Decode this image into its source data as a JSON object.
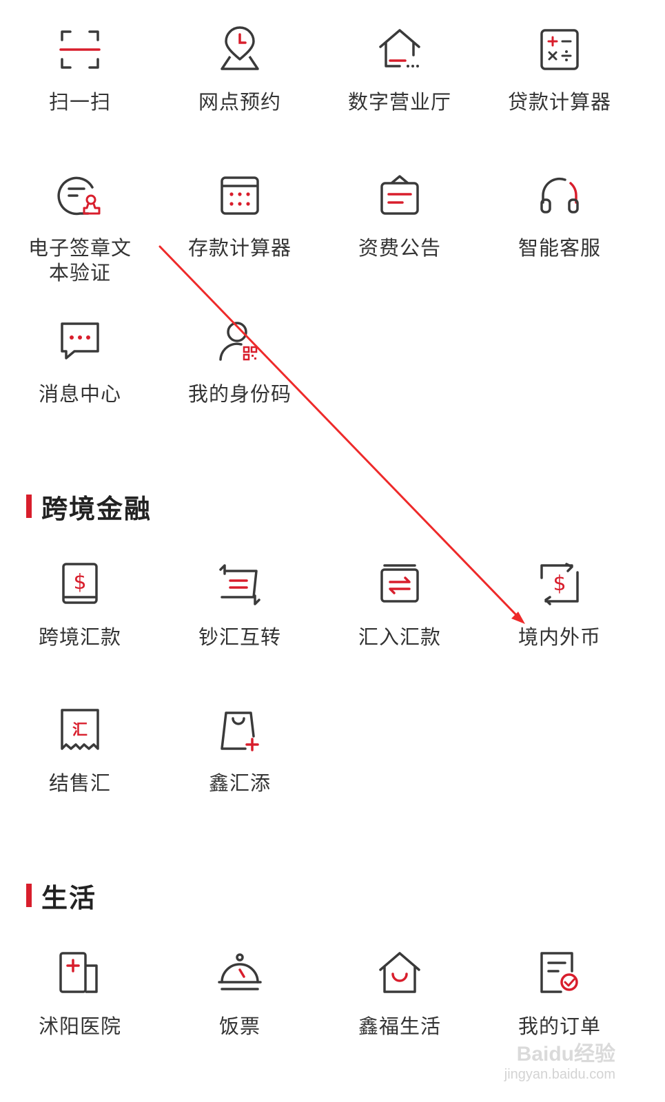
{
  "colors": {
    "accent": "#d81e2c",
    "icon_stroke": "#3a3a3a",
    "text": "#333333"
  },
  "services": [
    {
      "label": "扫一扫",
      "icon": "scan-icon"
    },
    {
      "label": "网点预约",
      "icon": "branch-appointment-icon"
    },
    {
      "label": "数字营业厅",
      "icon": "digital-hall-icon"
    },
    {
      "label": "贷款计算器",
      "icon": "calculator-icon"
    },
    {
      "label": "电子签章文本验证",
      "icon": "e-signature-icon"
    },
    {
      "label": "存款计算器",
      "icon": "calendar-grid-icon"
    },
    {
      "label": "资费公告",
      "icon": "announcement-icon"
    },
    {
      "label": "智能客服",
      "icon": "headset-icon"
    },
    {
      "label": "消息中心",
      "icon": "message-icon"
    },
    {
      "label": "我的身份码",
      "icon": "identity-code-icon"
    }
  ],
  "cross_border": {
    "title": "跨境金融",
    "items": [
      {
        "label": "跨境汇款",
        "icon": "dollar-remit-icon"
      },
      {
        "label": "钞汇互转",
        "icon": "exchange-icon"
      },
      {
        "label": "汇入汇款",
        "icon": "inbound-transfer-icon"
      },
      {
        "label": "境内外币",
        "icon": "domestic-fx-icon"
      },
      {
        "label": "结售汇",
        "icon": "receipt-icon"
      },
      {
        "label": "鑫汇添",
        "icon": "bag-add-icon"
      }
    ]
  },
  "life": {
    "title": "生活",
    "items": [
      {
        "label": "沭阳医院",
        "icon": "hospital-icon"
      },
      {
        "label": "饭票",
        "icon": "dining-bell-icon"
      },
      {
        "label": "鑫福生活",
        "icon": "home-smile-icon"
      },
      {
        "label": "我的订单",
        "icon": "order-icon"
      }
    ]
  },
  "watermark": {
    "logo": "Baidu经验",
    "url": "jingyan.baidu.com"
  }
}
